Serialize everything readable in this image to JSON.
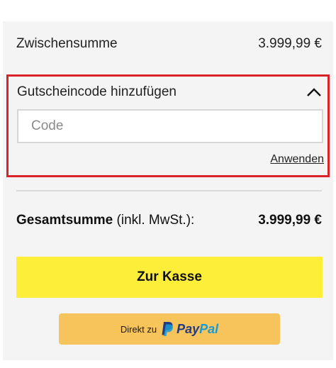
{
  "summary": {
    "subtotal_label": "Zwischensumme",
    "subtotal_value": "3.999,99 €",
    "total_label": "Gesamtsumme",
    "total_suffix": "(inkl. MwSt.):",
    "total_value": "3.999,99 €"
  },
  "voucher": {
    "toggle_label": "Gutscheincode hinzufügen",
    "code_value": "",
    "code_placeholder": "Code",
    "apply_label": "Anwenden",
    "toggle_icon": "chevron-up-icon",
    "highlight_color": "#d8232a"
  },
  "actions": {
    "checkout_label": "Zur Kasse",
    "checkout_color": "#fdee3a",
    "paypal_prefix": "Direkt zu",
    "paypal_word_1": "Pay",
    "paypal_word_2": "Pal",
    "paypal_button_color": "#f7c35b"
  }
}
